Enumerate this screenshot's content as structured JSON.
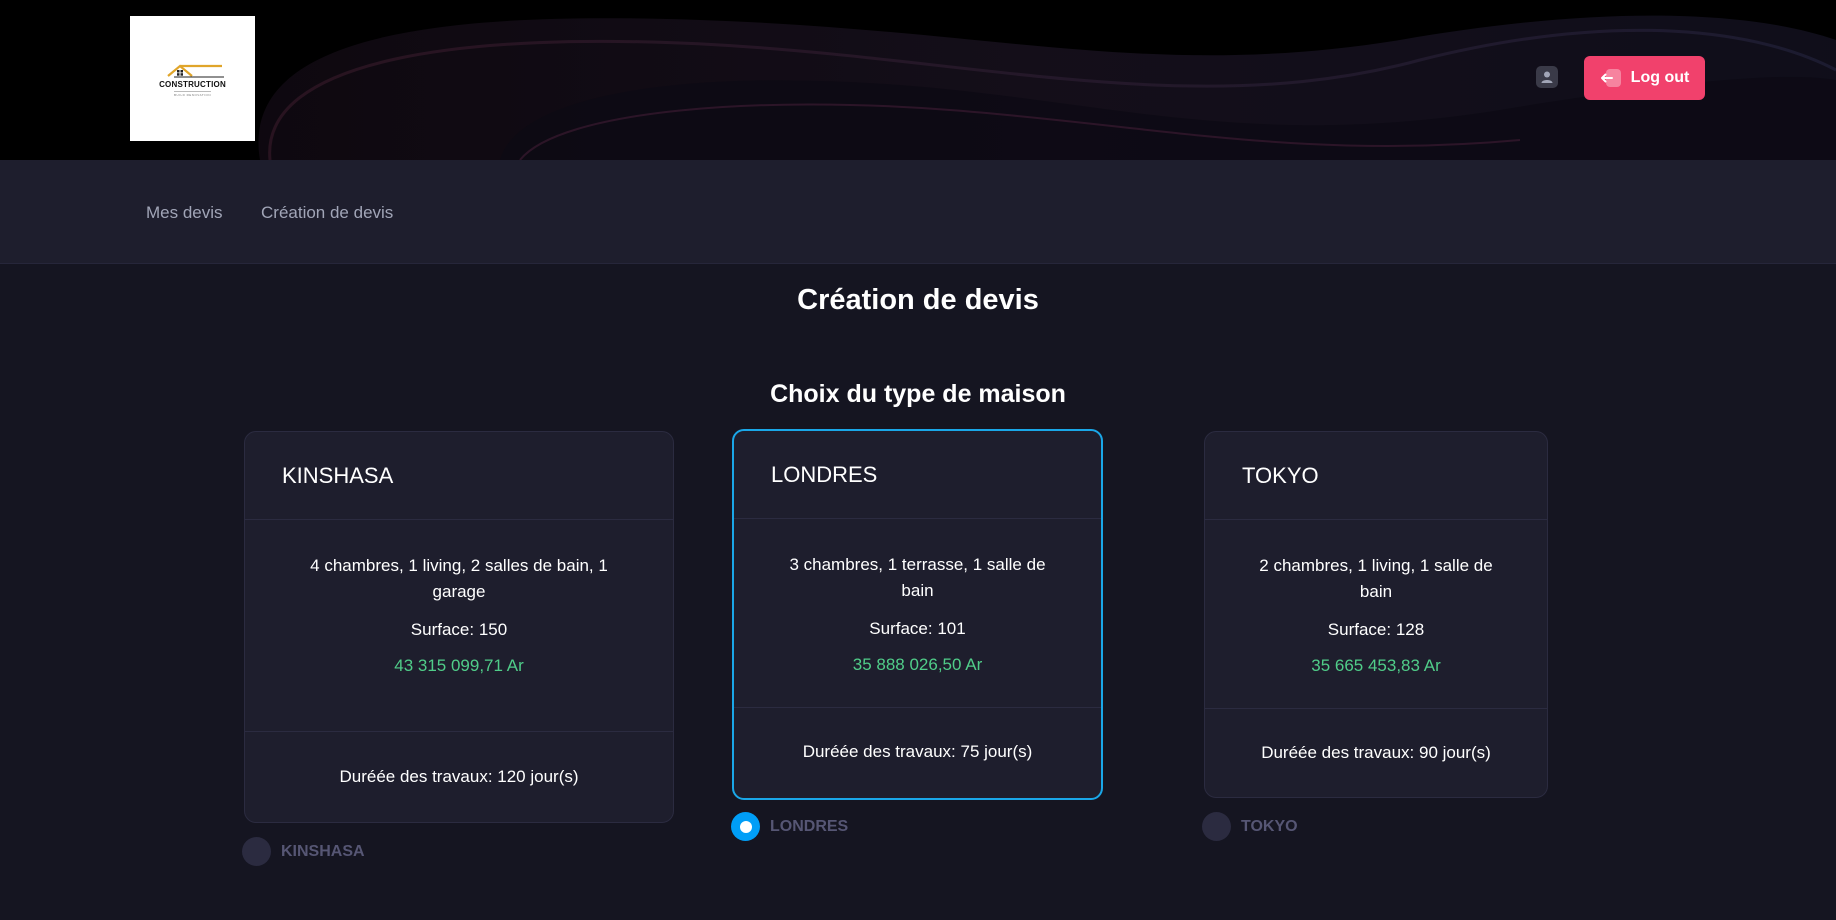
{
  "header": {
    "logo": {
      "brand": "CONSTRUCTION",
      "tagline": "BUILD RENOVATION",
      "roof_color": "#e0a52a"
    },
    "user_icon": "user-icon",
    "logout_label": "Log out",
    "logout_color": "#f1416c"
  },
  "nav": {
    "items": [
      {
        "label": "Mes devis"
      },
      {
        "label": "Création de devis"
      }
    ]
  },
  "main": {
    "title": "Création de devis",
    "section_title": "Choix du type de maison",
    "selected": "LONDRES",
    "houses": [
      {
        "name": "KINSHASA",
        "description": "4 chambres, 1 living, 2 salles de bain, 1 garage",
        "surface": "Surface: 150",
        "price": "43 315 099,71 Ar",
        "duration": "Duréée des travaux: 120 jour(s)",
        "radio_label": "KINSHASA",
        "checked": false
      },
      {
        "name": "LONDRES",
        "description": "3 chambres, 1 terrasse, 1 salle de bain",
        "surface": "Surface: 101",
        "price": "35 888 026,50 Ar",
        "duration": "Duréée des travaux: 75 jour(s)",
        "radio_label": "LONDRES",
        "checked": true
      },
      {
        "name": "TOKYO",
        "description": "2 chambres, 1 living, 1 salle de bain",
        "surface": "Surface: 128",
        "price": "35 665 453,83 Ar",
        "duration": "Duréée des travaux: 90 jour(s)",
        "radio_label": "TOKYO",
        "checked": false
      }
    ]
  },
  "colors": {
    "accent_selected": "#1aa7e8",
    "price_green": "#50cd89",
    "card_bg": "#1e1e2d",
    "page_bg": "#151521"
  }
}
